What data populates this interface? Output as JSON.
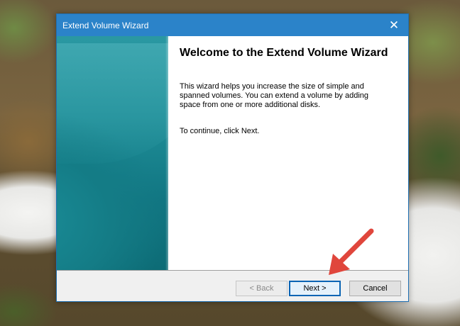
{
  "window": {
    "title": "Extend Volume Wizard",
    "close_glyph": "✕"
  },
  "content": {
    "heading": "Welcome to the Extend Volume Wizard",
    "description": "This wizard helps you increase the size of simple and spanned volumes. You can extend a volume  by adding space from one or more additional disks.",
    "instruction": "To continue, click Next."
  },
  "buttons": {
    "back": "< Back",
    "next": "Next >",
    "cancel": "Cancel"
  },
  "colors": {
    "titlebar": "#2b83c9",
    "side_panel": "#147c86",
    "annotation_arrow": "#e0463c"
  }
}
